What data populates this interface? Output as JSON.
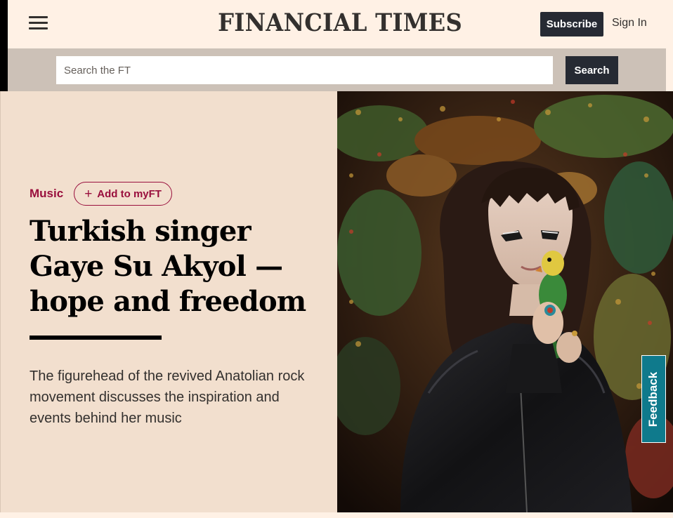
{
  "header": {
    "logo": "FINANCIAL TIMES",
    "subscribe_label": "Subscribe",
    "signin_label": "Sign In",
    "menu_icon": "hamburger-menu-icon"
  },
  "search": {
    "placeholder": "Search the FT",
    "button_label": "Search"
  },
  "article": {
    "topic": "Music",
    "myft_label": "Add to myFT",
    "headline": "Turkish singer Gaye Su Akyol — hope and freedom",
    "standfirst": "The figurehead of the revived Anatolian rock movement discusses the inspiration and events behind her music"
  },
  "feedback": {
    "label": "Feedback"
  },
  "colors": {
    "page_bg": "#fff1e5",
    "hero_bg": "#f2dfce",
    "claret": "#990f3d",
    "dark_button": "#262a33",
    "search_band": "#ccc1b7",
    "feedback_teal": "#0f7a8c"
  }
}
